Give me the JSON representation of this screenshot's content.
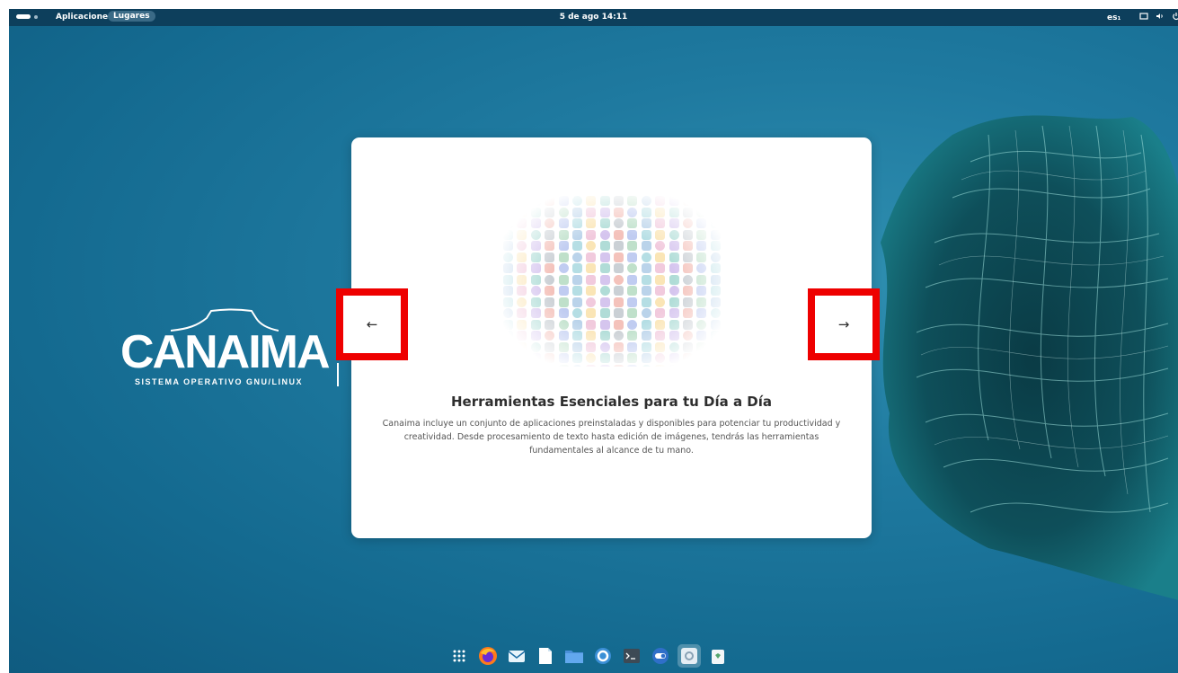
{
  "topbar": {
    "applications": "Aplicaciones",
    "places": "Lugares",
    "clock": "5 de ago  14:11",
    "keyboard": "es₁"
  },
  "logo": {
    "wordmark": "CANAIMA",
    "subtitle": "SISTEMA OPERATIVO GNU/LINUX"
  },
  "dialog": {
    "title": "Herramientas Esenciales para tu Día a Día",
    "description": "Canaima incluye un conjunto de aplicaciones preinstaladas y disponibles para potenciar tu productividad y creatividad. Desde procesamiento de texto hasta edición de imágenes, tendrás las herramientas fundamentales al alcance de tu mano.",
    "prev_arrow": "←",
    "next_arrow": "→"
  },
  "dock": {
    "items": [
      {
        "icon": "app-grid-icon"
      },
      {
        "icon": "firefox-icon"
      },
      {
        "icon": "mail-icon"
      },
      {
        "icon": "text-editor-icon"
      },
      {
        "icon": "files-icon"
      },
      {
        "icon": "help-icon"
      },
      {
        "icon": "terminal-icon"
      },
      {
        "icon": "toggle-icon"
      },
      {
        "icon": "settings-icon"
      },
      {
        "icon": "trash-icon"
      }
    ]
  },
  "colors": {
    "topbar": "#0d3f5c",
    "desktop": "#1f7aa0",
    "highlight": "#ee0000"
  }
}
